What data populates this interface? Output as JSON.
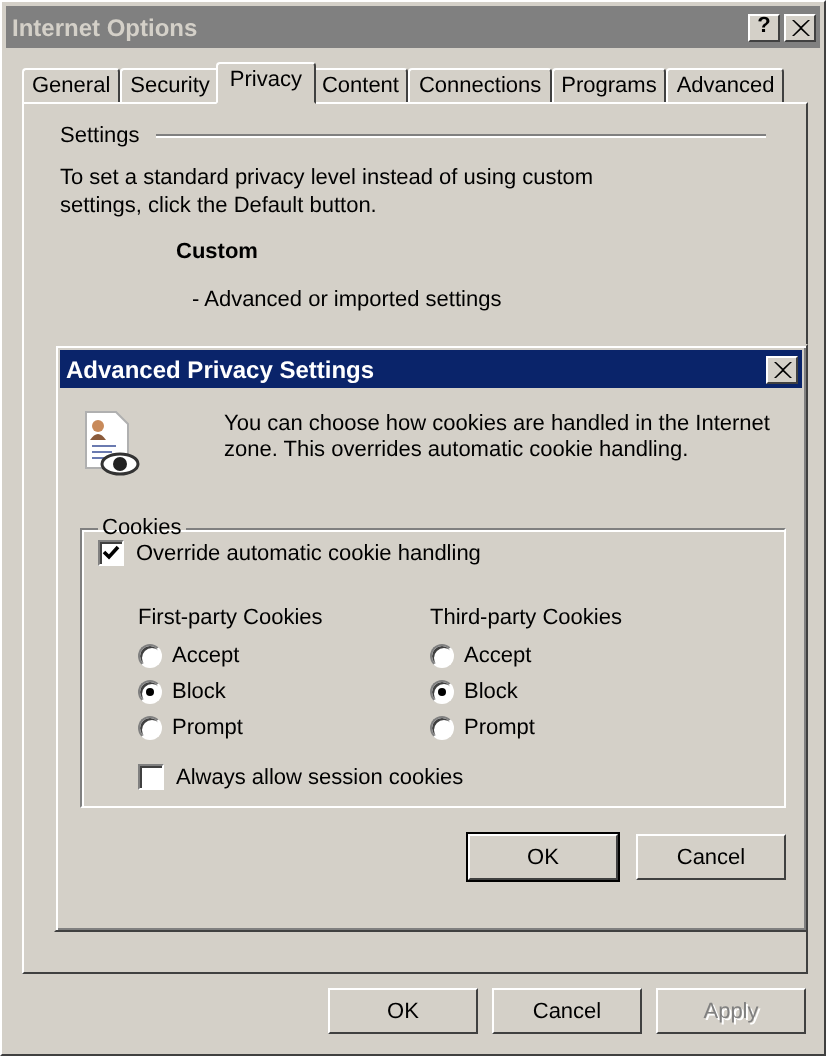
{
  "window": {
    "title": "Internet Options",
    "help_button": "?"
  },
  "tabs": [
    {
      "label": "General",
      "selected": false
    },
    {
      "label": "Security",
      "selected": false
    },
    {
      "label": "Privacy",
      "selected": true
    },
    {
      "label": "Content",
      "selected": false
    },
    {
      "label": "Connections",
      "selected": false
    },
    {
      "label": "Programs",
      "selected": false
    },
    {
      "label": "Advanced",
      "selected": false
    }
  ],
  "settings": {
    "heading": "Settings",
    "intro": "To set a standard privacy level instead of using custom settings, click the Default button.",
    "level_name": "Custom",
    "level_description": "- Advanced or imported settings"
  },
  "buttons": [
    {
      "label": "OK",
      "disabled": false
    },
    {
      "label": "Cancel",
      "disabled": false
    },
    {
      "label": "Apply",
      "disabled": true
    }
  ],
  "dialog": {
    "title": "Advanced Privacy Settings",
    "intro": "You can choose how cookies are handled in the Internet zone.  This overrides automatic cookie handling.",
    "cookies": {
      "heading": "Cookies",
      "override": {
        "label": "Override automatic cookie handling",
        "checked": true
      },
      "groups": [
        {
          "heading": "First-party Cookies",
          "options": [
            {
              "label": "Accept",
              "selected": false
            },
            {
              "label": "Block",
              "selected": true
            },
            {
              "label": "Prompt",
              "selected": false
            }
          ]
        },
        {
          "heading": "Third-party Cookies",
          "options": [
            {
              "label": "Accept",
              "selected": false
            },
            {
              "label": "Block",
              "selected": true
            },
            {
              "label": "Prompt",
              "selected": false
            }
          ]
        }
      ],
      "session": {
        "label": "Always allow session cookies",
        "checked": false
      }
    },
    "buttons": [
      {
        "label": "OK",
        "default": true
      },
      {
        "label": "Cancel",
        "default": false
      }
    ]
  }
}
